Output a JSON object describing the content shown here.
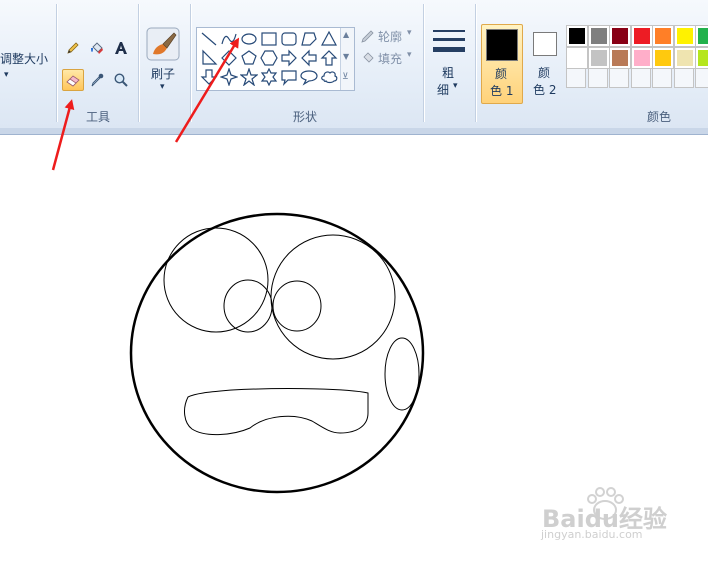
{
  "image_group": {
    "resize_label": "调整大小"
  },
  "tools_group": {
    "label": "工具"
  },
  "brush": {
    "label": "刷子"
  },
  "shapes_group": {
    "label": "形状",
    "outline_label": "轮廓",
    "fill_label": "填充"
  },
  "size": {
    "label_line1": "粗",
    "label_line2": "细"
  },
  "color1": {
    "label_line1": "颜",
    "label_line2": "色 1",
    "value": "#000000"
  },
  "color2": {
    "label_line1": "颜",
    "label_line2": "色 2",
    "value": "#ffffff"
  },
  "colors_group": {
    "label": "颜色",
    "row1": [
      "#000000",
      "#7f7f7f",
      "#880015",
      "#ed1c24",
      "#ff7f27",
      "#fff200",
      "#22b14c"
    ],
    "row2": [
      "#ffffff",
      "#c3c3c3",
      "#b97a57",
      "#ffaec9",
      "#ffc90e",
      "#efe4b0",
      "#b5e61d"
    ]
  },
  "watermark": {
    "brand": "Baidu经验",
    "url": "jingyan.baidu.com"
  },
  "icons": [
    "pencil-icon",
    "fill-bucket-icon",
    "text-icon",
    "eraser-icon",
    "color-picker-icon",
    "magnifier-icon",
    "brush-icon"
  ]
}
